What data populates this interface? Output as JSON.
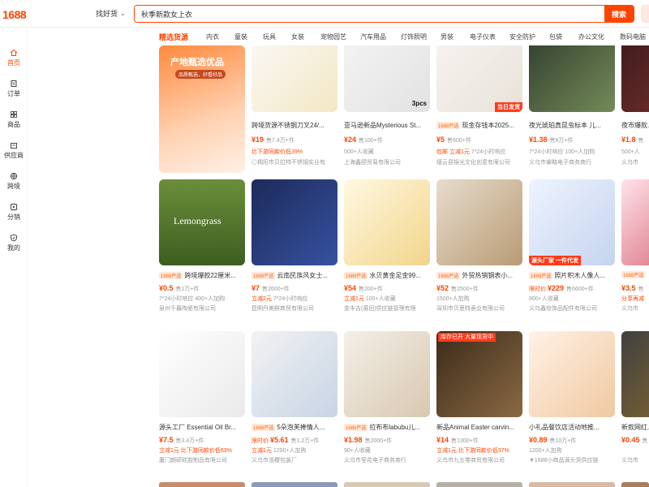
{
  "header": {
    "logo": "1688",
    "mode_label": "找好货",
    "search_value": "秋季新款女上衣",
    "search_button": "搜索"
  },
  "sidebar": {
    "items": [
      {
        "label": "首页",
        "icon": "home-icon",
        "active": true
      },
      {
        "label": "订单",
        "icon": "order-icon",
        "active": false
      },
      {
        "label": "商品",
        "icon": "grid-icon",
        "active": false
      },
      {
        "label": "供应商",
        "icon": "store-icon",
        "active": false
      },
      {
        "label": "跨境",
        "icon": "globe-icon",
        "active": false
      },
      {
        "label": "分销",
        "icon": "share-icon",
        "active": false
      },
      {
        "label": "我的",
        "icon": "user-shield-icon",
        "active": false
      }
    ]
  },
  "categories": [
    "精选货源",
    "内衣",
    "童装",
    "玩具",
    "女装",
    "宠物园艺",
    "汽车用品",
    "灯饰照明",
    "男装",
    "电子仪表",
    "安全防护",
    "包袋",
    "办公文化",
    "数码电脑"
  ],
  "products": [
    {
      "title": "",
      "price": "",
      "sold": "",
      "sub": "",
      "seller": "",
      "banner_title": "产地甄选优品",
      "banner_sub": "品质甄选，好看好品"
    },
    {
      "title": "跨境货源不锈钢刀叉24/...",
      "price": "¥19",
      "sold": "售7.4万+件",
      "sub_promo": "比下游同款价低39%",
      "sub": "",
      "seller": "◎揭阳市贝拉特不锈钢实业有"
    },
    {
      "title": "亚马逊新品Mysterious St...",
      "price": "¥24",
      "sold": "售100+件",
      "sub": "500+人收藏",
      "seller": "上海鑫颐贸易有限公司",
      "img_tag": "3pcs"
    },
    {
      "title": "现金存钱本2025...",
      "badge": "1688严选",
      "price": "¥5",
      "sold": "售600+件",
      "sub_promo": "包邮  立减1元",
      "sub": "7*24小时响应",
      "seller": "缙云县锦光文化创意有限公司",
      "img_tag": "当日发货"
    },
    {
      "title": "夜光琥珀真昆虫标本 儿...",
      "price": "¥1.38",
      "sold": "售8万+件",
      "sub": "7*24小时响应  100+人加购",
      "seller": "义乌市睿略电子商务商行"
    },
    {
      "title": "夜市爆款...",
      "price": "¥1.8",
      "sold": "售",
      "sub": "500+人",
      "seller": "义乌市"
    },
    {
      "title": "跨境爆款22厘米...",
      "badge": "1688严选",
      "price": "¥0.5",
      "sold": "售1万+件",
      "sub": "7*24小时响应  400+人加购",
      "seller": "泉州千暮陶瓷有限公司",
      "img_text": "Lemongrass"
    },
    {
      "title": "云南民族风女士...",
      "badge": "1688严选",
      "price": "¥7",
      "sold": "售2600+件",
      "sub_promo": "立减2元",
      "sub": "7*24小时响应",
      "seller": "昆明丹美鲜商贸有限公司"
    },
    {
      "title": "水贝黄金足金99...",
      "badge": "1688严选",
      "price": "¥54",
      "sold": "售200+件",
      "sub_promo": "立减1元",
      "sub": "100+人收藏",
      "seller": "金丰吉(莆田)供应链管理有限"
    },
    {
      "title": "外贸热销钢表小...",
      "badge": "1688严选",
      "price": "¥52",
      "sold": "售2500+件",
      "sub": "1500+人加购",
      "seller": "深圳市贝思特表业有限公司"
    },
    {
      "title": "照片积木人像人...",
      "badge": "1688严选",
      "pre": "限时价",
      "price": "¥229",
      "sold": "售6600+件",
      "sub": "800+人收藏",
      "seller": "义乌鑫怡饰品配件有限公司",
      "img_tag": "源头厂家 一件代发"
    },
    {
      "title": "...",
      "badge": "1688严选",
      "price": "¥3.5",
      "sold": "售",
      "sub_promo": "分享再减",
      "sub": "",
      "seller": "义乌市"
    },
    {
      "title": "源头工厂 Essential Oil Br...",
      "price": "¥7.5",
      "sold": "售3.4万+件",
      "sub_promo": "立减1元  比下游同款价低63%",
      "sub": "",
      "seller": "厦门朗硕硅胶制品有限公司"
    },
    {
      "title": "5朵泡芙捧情人...",
      "badge": "1688严选",
      "pre": "限时价",
      "price": "¥5.61",
      "sold": "售1.2万+件",
      "sub_promo": "立减1元",
      "sub": "1200+人加购",
      "seller": "义乌市浩樱包装厂"
    },
    {
      "title": "拉布布labubu儿...",
      "badge": "1688严选",
      "price": "¥1.98",
      "sold": "售2000+件",
      "sub": "90+人收藏",
      "seller": "义乌市莹花电子商务商行"
    },
    {
      "title": "新品Animal Easter carvin...",
      "price": "¥14",
      "sold": "售1300+件",
      "sub_promo": "立减1元  比下游同款价低37%",
      "sub": "",
      "seller": "义乌市九五零商贸有限公司",
      "img_tag": "库存已开 大量现货中"
    },
    {
      "title": "小礼品餐饮店活动地推...",
      "price": "¥0.89",
      "sold": "售10万+件",
      "sub": "1200+人加购",
      "seller": "▼1688小商品源头货供应链"
    },
    {
      "title": "新款网红...",
      "price": "¥0.45",
      "sold": "售",
      "sub": "",
      "seller": "义乌市"
    }
  ],
  "colors": {
    "accent": "#ff4400",
    "badge_bg": "#ffe8dd"
  }
}
